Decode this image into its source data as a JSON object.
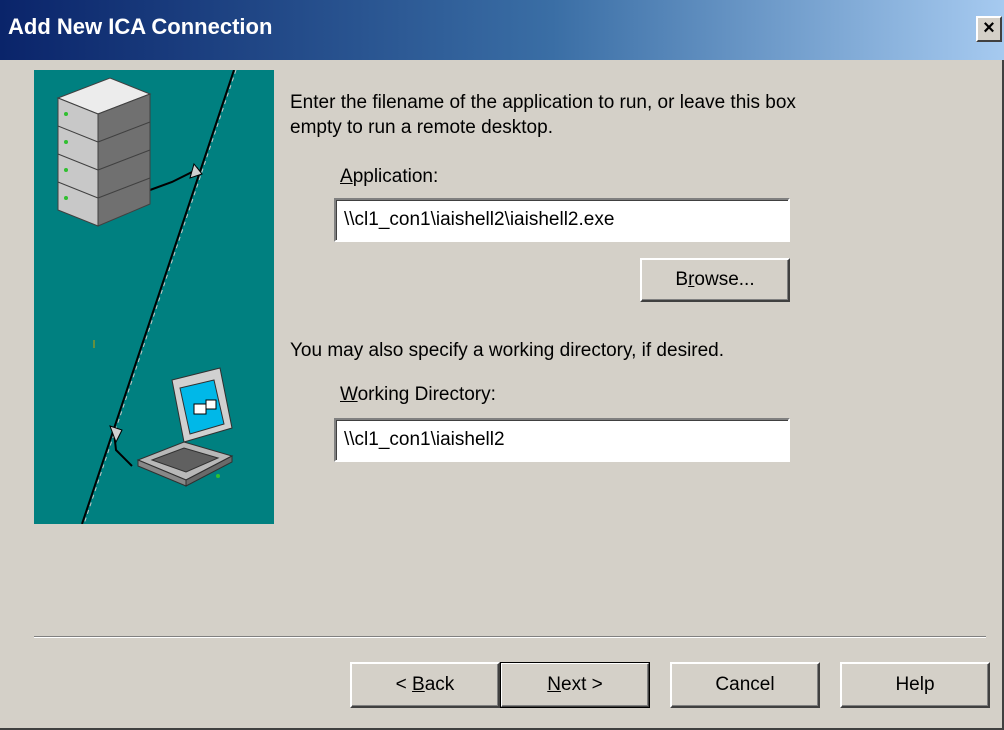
{
  "window": {
    "title": "Add New ICA Connection",
    "close_glyph": "×"
  },
  "instructions": {
    "application_prompt": "Enter the filename of the application to run, or leave this box empty to run a remote desktop.",
    "working_dir_prompt": "You may also specify a working directory, if desired."
  },
  "fields": {
    "application": {
      "label_mnemonic": "A",
      "label_rest": "pplication:",
      "value": "\\\\cl1_con1\\iaishell2\\iaishell2.exe"
    },
    "working_directory": {
      "label_mnemonic": "W",
      "label_rest": "orking Directory:",
      "value": "\\\\cl1_con1\\iaishell2"
    }
  },
  "buttons": {
    "browse": {
      "pre": "B",
      "mnemonic": "r",
      "post": "owse..."
    },
    "back": {
      "pre": "< ",
      "mnemonic": "B",
      "post": "ack"
    },
    "next": {
      "pre": "",
      "mnemonic": "N",
      "post": "ext >"
    },
    "cancel": "Cancel",
    "help": "Help"
  },
  "colors": {
    "illustration_bg": "#008080",
    "titlebar_start": "#0a246a",
    "titlebar_end": "#a6caf0",
    "dialog_bg": "#d4d0c8"
  },
  "icons": [
    "close-icon",
    "server-stack-icon",
    "laptop-icon",
    "network-cable-icon"
  ]
}
